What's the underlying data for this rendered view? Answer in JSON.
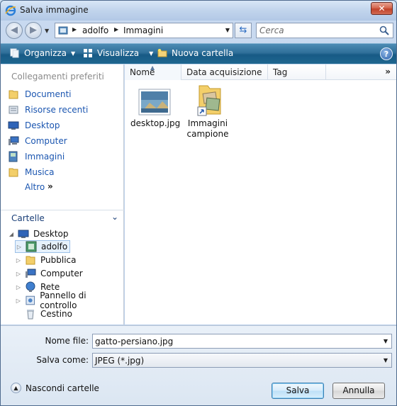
{
  "window": {
    "title": "Salva immagine"
  },
  "address": {
    "path": [
      "adolfo",
      "Immagini"
    ]
  },
  "search": {
    "placeholder": "Cerca"
  },
  "toolbar": {
    "organize_label": "Organizza",
    "view_label": "Visualizza",
    "new_folder_label": "Nuova cartella"
  },
  "sidebar": {
    "favorites_header": "Collegamenti preferiti",
    "favorites": [
      {
        "label": "Documenti",
        "icon": "documents-folder-icon"
      },
      {
        "label": "Risorse recenti",
        "icon": "recent-places-icon"
      },
      {
        "label": "Desktop",
        "icon": "desktop-icon"
      },
      {
        "label": "Computer",
        "icon": "computer-icon"
      },
      {
        "label": "Immagini",
        "icon": "pictures-icon"
      },
      {
        "label": "Musica",
        "icon": "music-folder-icon"
      }
    ],
    "more_label": "Altro",
    "folders_header": "Cartelle",
    "tree": [
      {
        "label": "Desktop",
        "icon": "desktop-icon"
      },
      {
        "label": "adolfo",
        "icon": "user-folder-icon"
      },
      {
        "label": "Pubblica",
        "icon": "folder-icon"
      },
      {
        "label": "Computer",
        "icon": "computer-icon"
      },
      {
        "label": "Rete",
        "icon": "network-icon"
      },
      {
        "label": "Pannello di controllo",
        "icon": "control-panel-icon"
      },
      {
        "label": "Cestino",
        "icon": "recycle-bin-icon"
      }
    ]
  },
  "columns": [
    "Nome",
    "Data acquisizione",
    "Tag"
  ],
  "files": [
    {
      "name": "desktop.jpg",
      "icon": "image-thumbnail-icon"
    },
    {
      "name_line1": "Immagini",
      "name_line2": "campione",
      "icon": "folder-shortcut-icon"
    }
  ],
  "form": {
    "filename_label": "Nome file:",
    "filename_value": "gatto-persiano.jpg",
    "filetype_label": "Salva come:",
    "filetype_value": "JPEG (*.jpg)"
  },
  "footer": {
    "hide_folders_label": "Nascondi cartelle",
    "save_label": "Salva",
    "cancel_label": "Annulla"
  },
  "colors": {
    "toolbar": "#1f6790",
    "link": "#1a55b0",
    "title_close": "#c0422a"
  }
}
